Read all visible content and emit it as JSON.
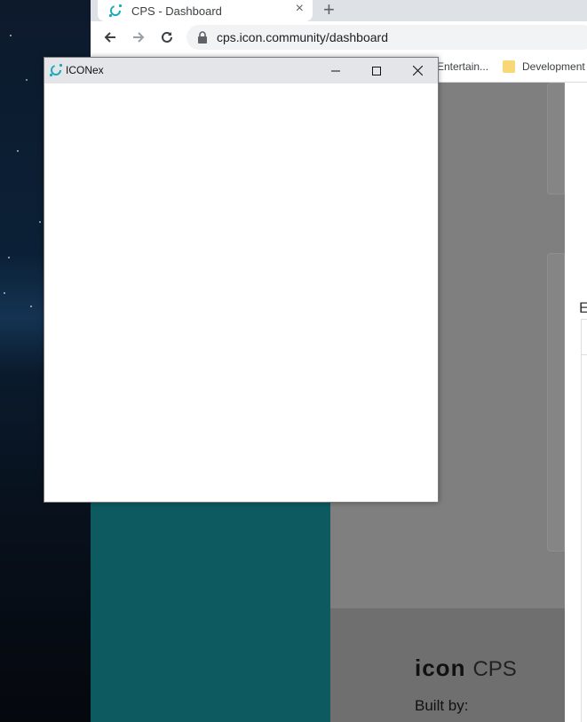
{
  "browser": {
    "tab_title": "CPS - Dashboard",
    "tab_close": "×",
    "new_tab": "+",
    "url": "cps.icon.community/dashboard",
    "bookmarks": [
      {
        "label": "Entertain..."
      },
      {
        "label": "Development"
      }
    ]
  },
  "page": {
    "right_panel_letter": "E",
    "footer": {
      "logo": "icon",
      "logo_suffix": "CPS",
      "built_by": "Built by:"
    }
  },
  "iconex_window": {
    "title": "ICONex",
    "icons": [
      "minimize-icon",
      "maximize-icon",
      "close-icon"
    ]
  },
  "colors": {
    "teal_sidebar": "#0d5a60",
    "icon_accent": "#1aaaba",
    "overlay_gray": "#7f7f7f"
  }
}
